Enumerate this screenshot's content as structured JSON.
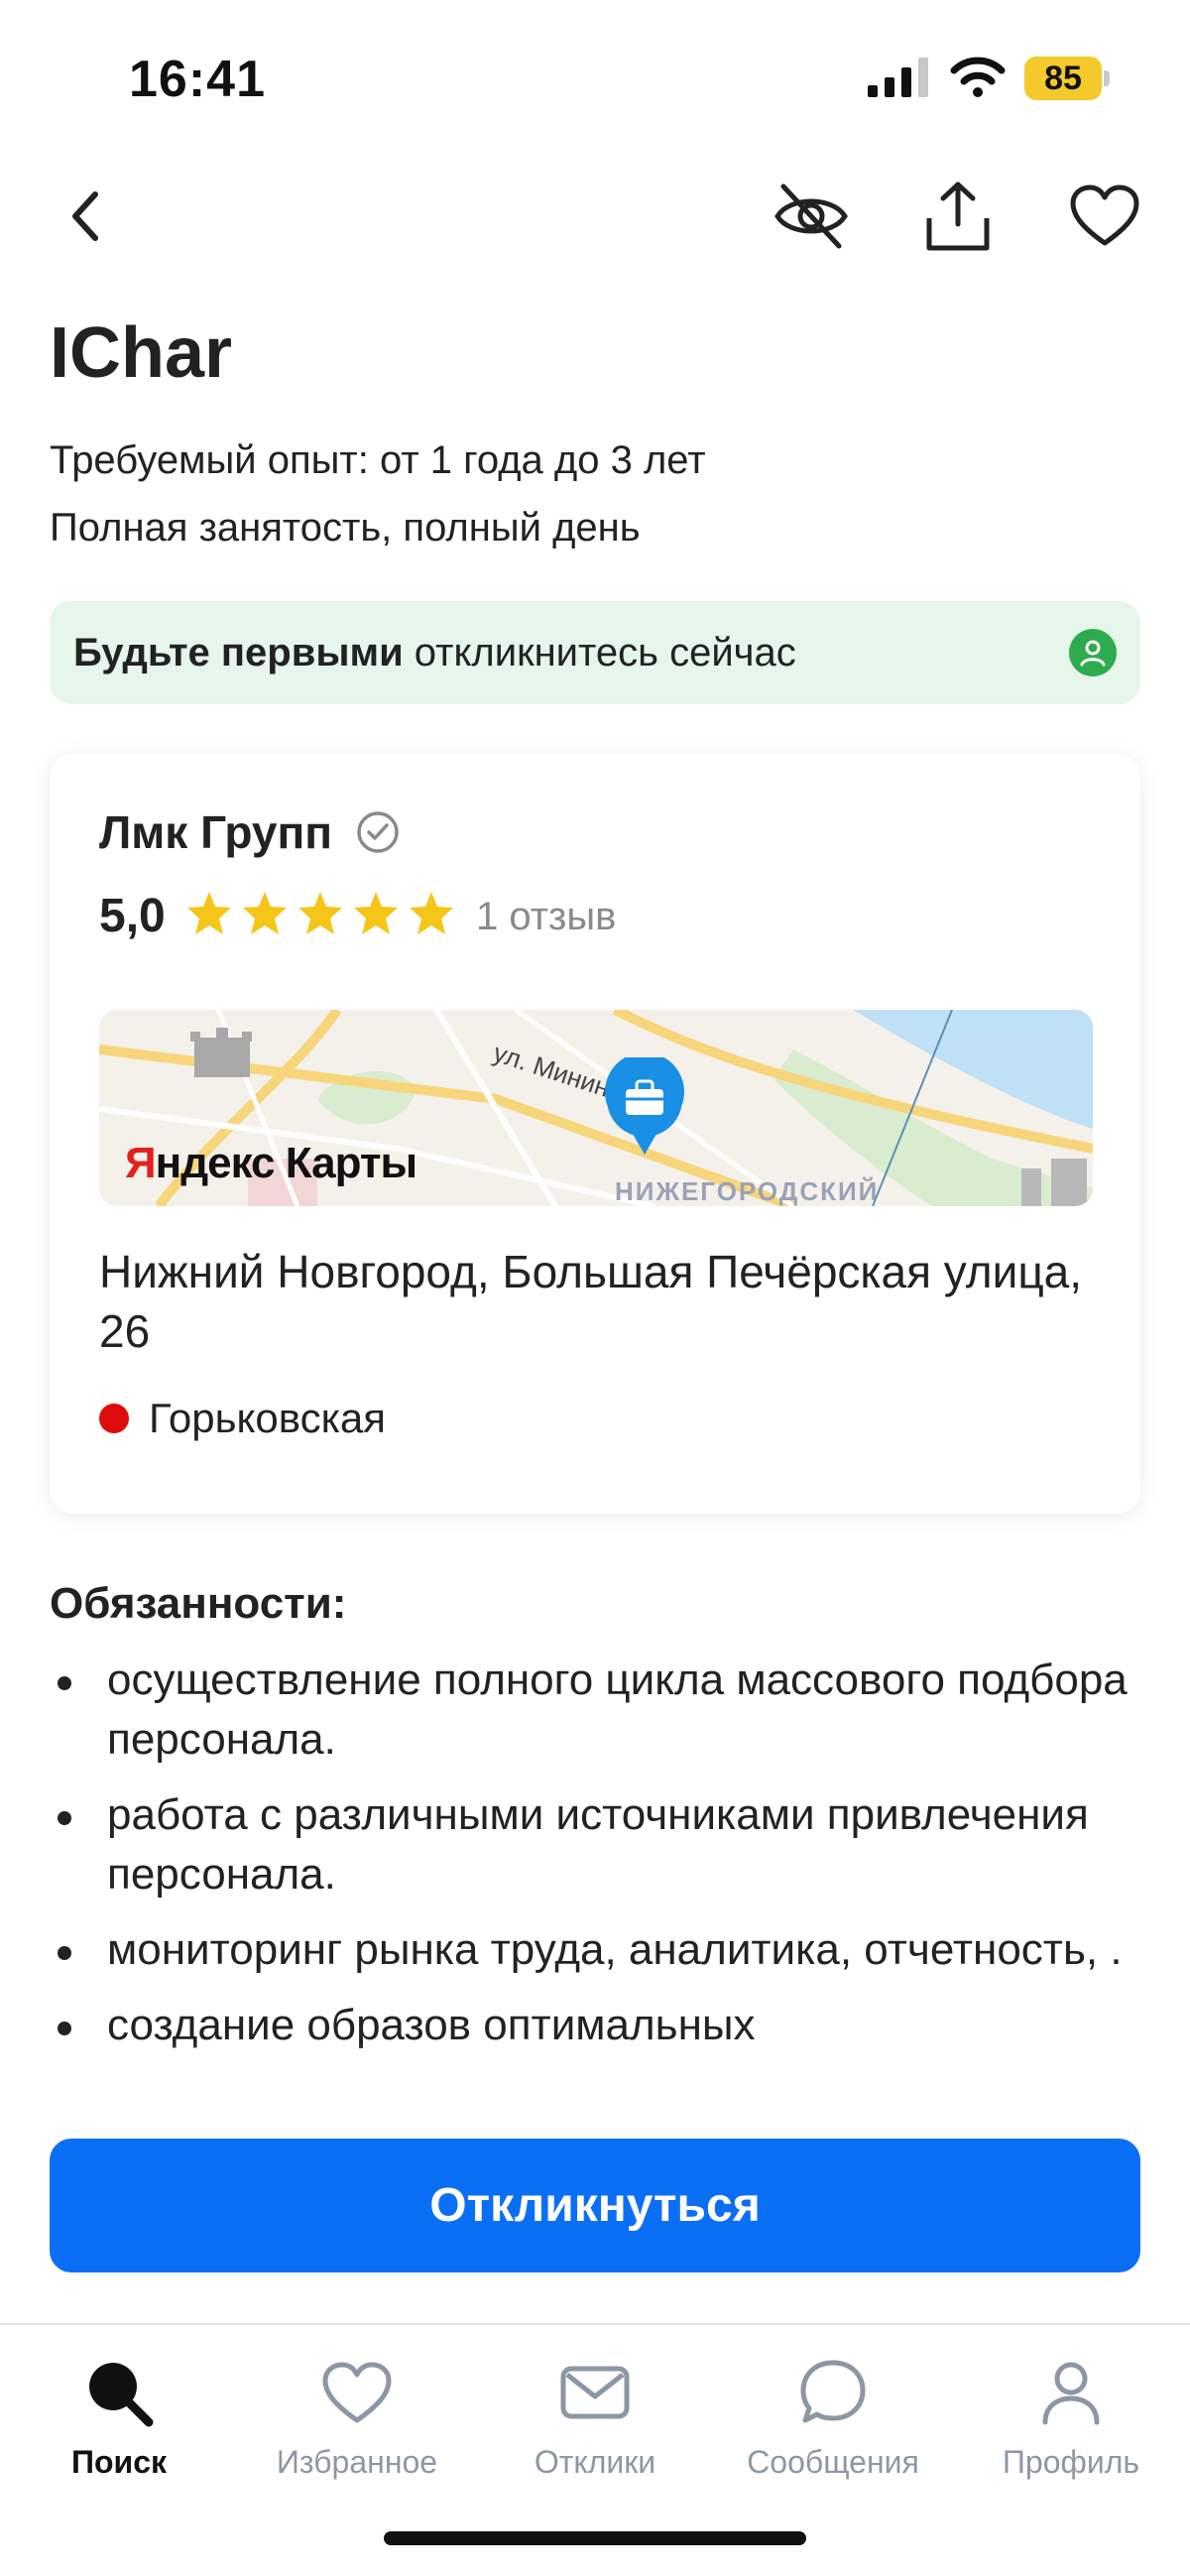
{
  "status_bar": {
    "time": "16:41",
    "battery": "85",
    "battery_color": "#f4c92b"
  },
  "vacancy": {
    "title": "IChar",
    "experience": "Требуемый опыт: от 1 года до 3 лет",
    "employment": "Полная занятость, полный день"
  },
  "banner": {
    "bold_text": "Будьте первыми",
    "text": " откликнитесь сейчас"
  },
  "company": {
    "name": "Лмк Групп",
    "rating": "5,0",
    "stars": 5,
    "reviews": "1 отзыв",
    "map_logo_y": "Я",
    "map_logo_rest": "ндекс Карты",
    "map_street_label": "ул. Минина",
    "map_district_label": "НИЖЕГОРОДСКИЙ",
    "address": "Нижний Новгород, Большая Печёрская улица, 26",
    "metro": "Горьковская",
    "metro_color": "#e00b0b"
  },
  "duties": {
    "title": "Обязанности:",
    "items": [
      "осуществление полного цикла массового подбора персонала.",
      "работа с различными источниками привлечения персонала.",
      "мониторинг рынка труда, аналитика, отчетность, .",
      "создание образов оптимальных"
    ]
  },
  "apply_button": {
    "label": "Откликнуться",
    "color": "#0b6ff5"
  },
  "tabbar": {
    "tabs": [
      {
        "label": "Поиск",
        "icon": "search-icon",
        "active": true
      },
      {
        "label": "Избранное",
        "icon": "heart-icon",
        "active": false
      },
      {
        "label": "Отклики",
        "icon": "envelope-icon",
        "active": false
      },
      {
        "label": "Сообщения",
        "icon": "chat-bubble-icon",
        "active": false
      },
      {
        "label": "Профиль",
        "icon": "person-icon",
        "active": false
      }
    ]
  }
}
